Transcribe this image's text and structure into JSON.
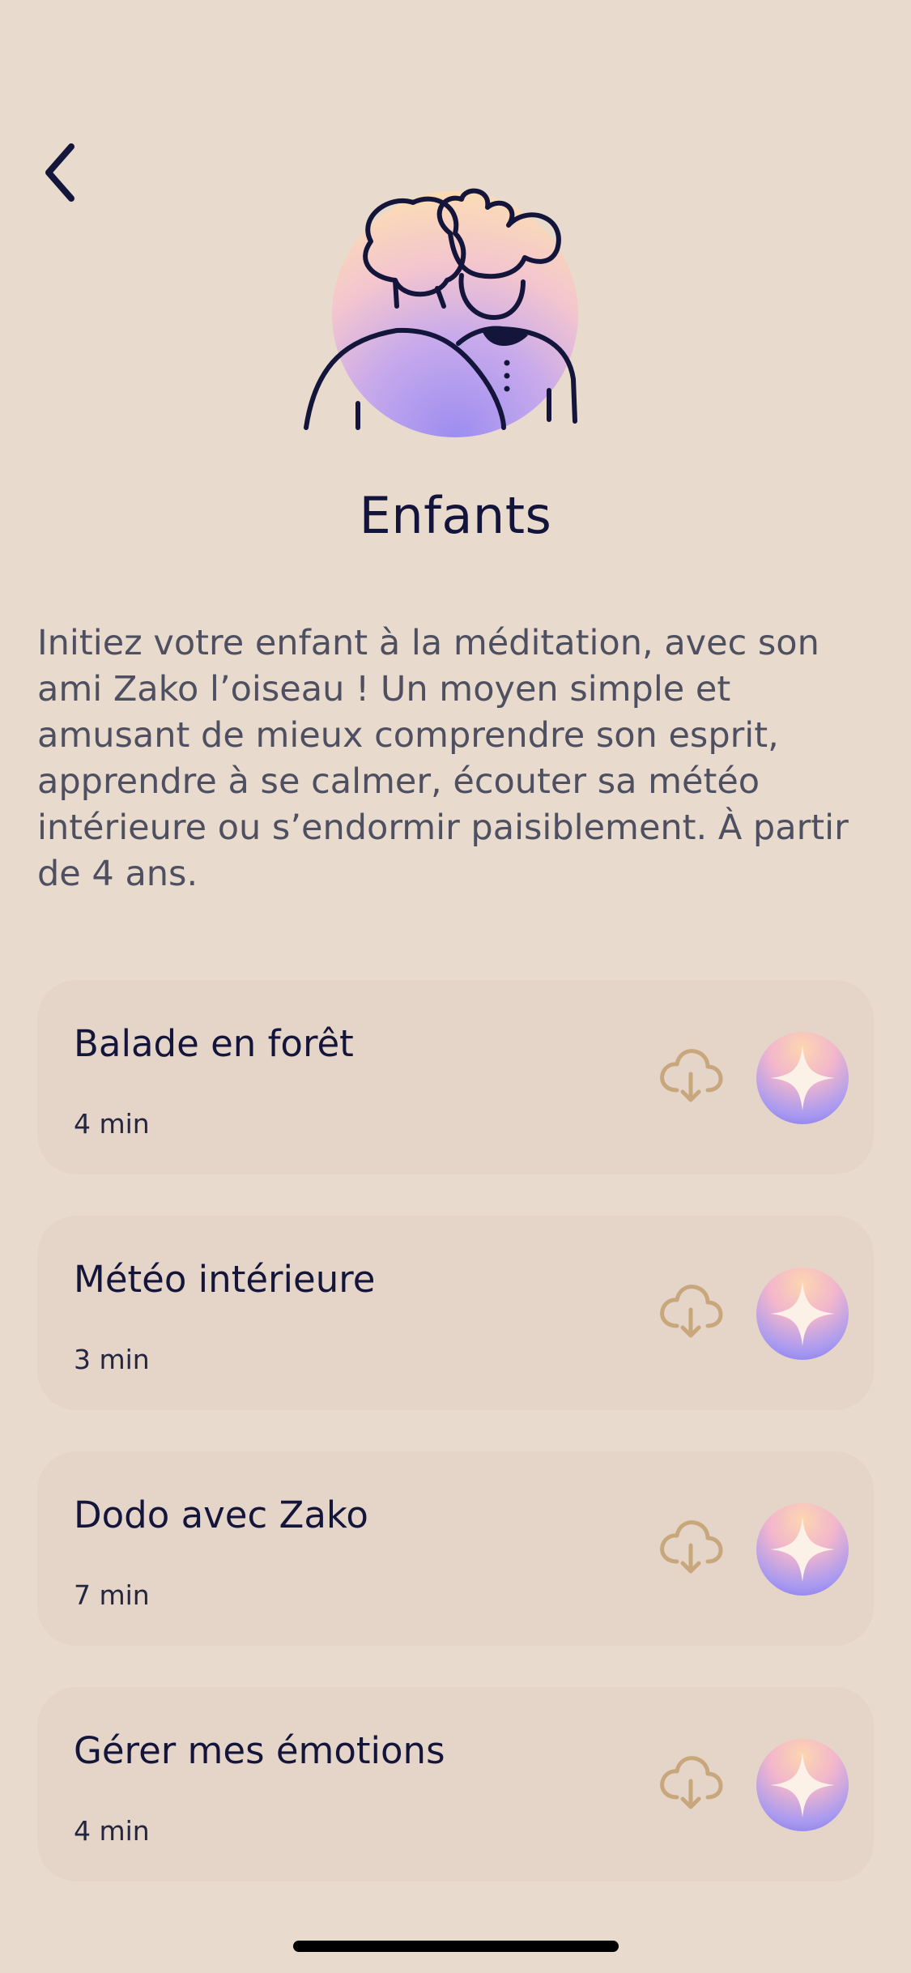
{
  "header": {
    "back_icon": "chevron-left-icon",
    "illustration_icon": "two-people-illustration-icon"
  },
  "page": {
    "title": "Enfants",
    "description": "Initiez votre enfant à la méditation, avec son ami Zako l’oiseau ! Un moyen simple et amusant de mieux comprendre son esprit, apprendre à se calmer, écouter sa météo intérieure ou s’endormir paisiblement. À partir de 4 ans."
  },
  "sessions": [
    {
      "title": "Balade en forêt",
      "duration": "4 min"
    },
    {
      "title": "Météo intérieure",
      "duration": "3 min"
    },
    {
      "title": "Dodo avec Zako",
      "duration": "7 min"
    },
    {
      "title": "Gérer mes émotions",
      "duration": "4 min"
    }
  ],
  "icons": {
    "download": "cloud-download-icon",
    "play": "sparkle-play-icon"
  },
  "colors": {
    "background": "#e8dbcd",
    "card": "#e5d5c8",
    "text_primary": "#13153a",
    "text_secondary": "#4e5061",
    "download_icon": "#c8a77c",
    "accent_gradient_top": "#fcd6b0",
    "accent_gradient_bottom": "#7f73ea"
  }
}
